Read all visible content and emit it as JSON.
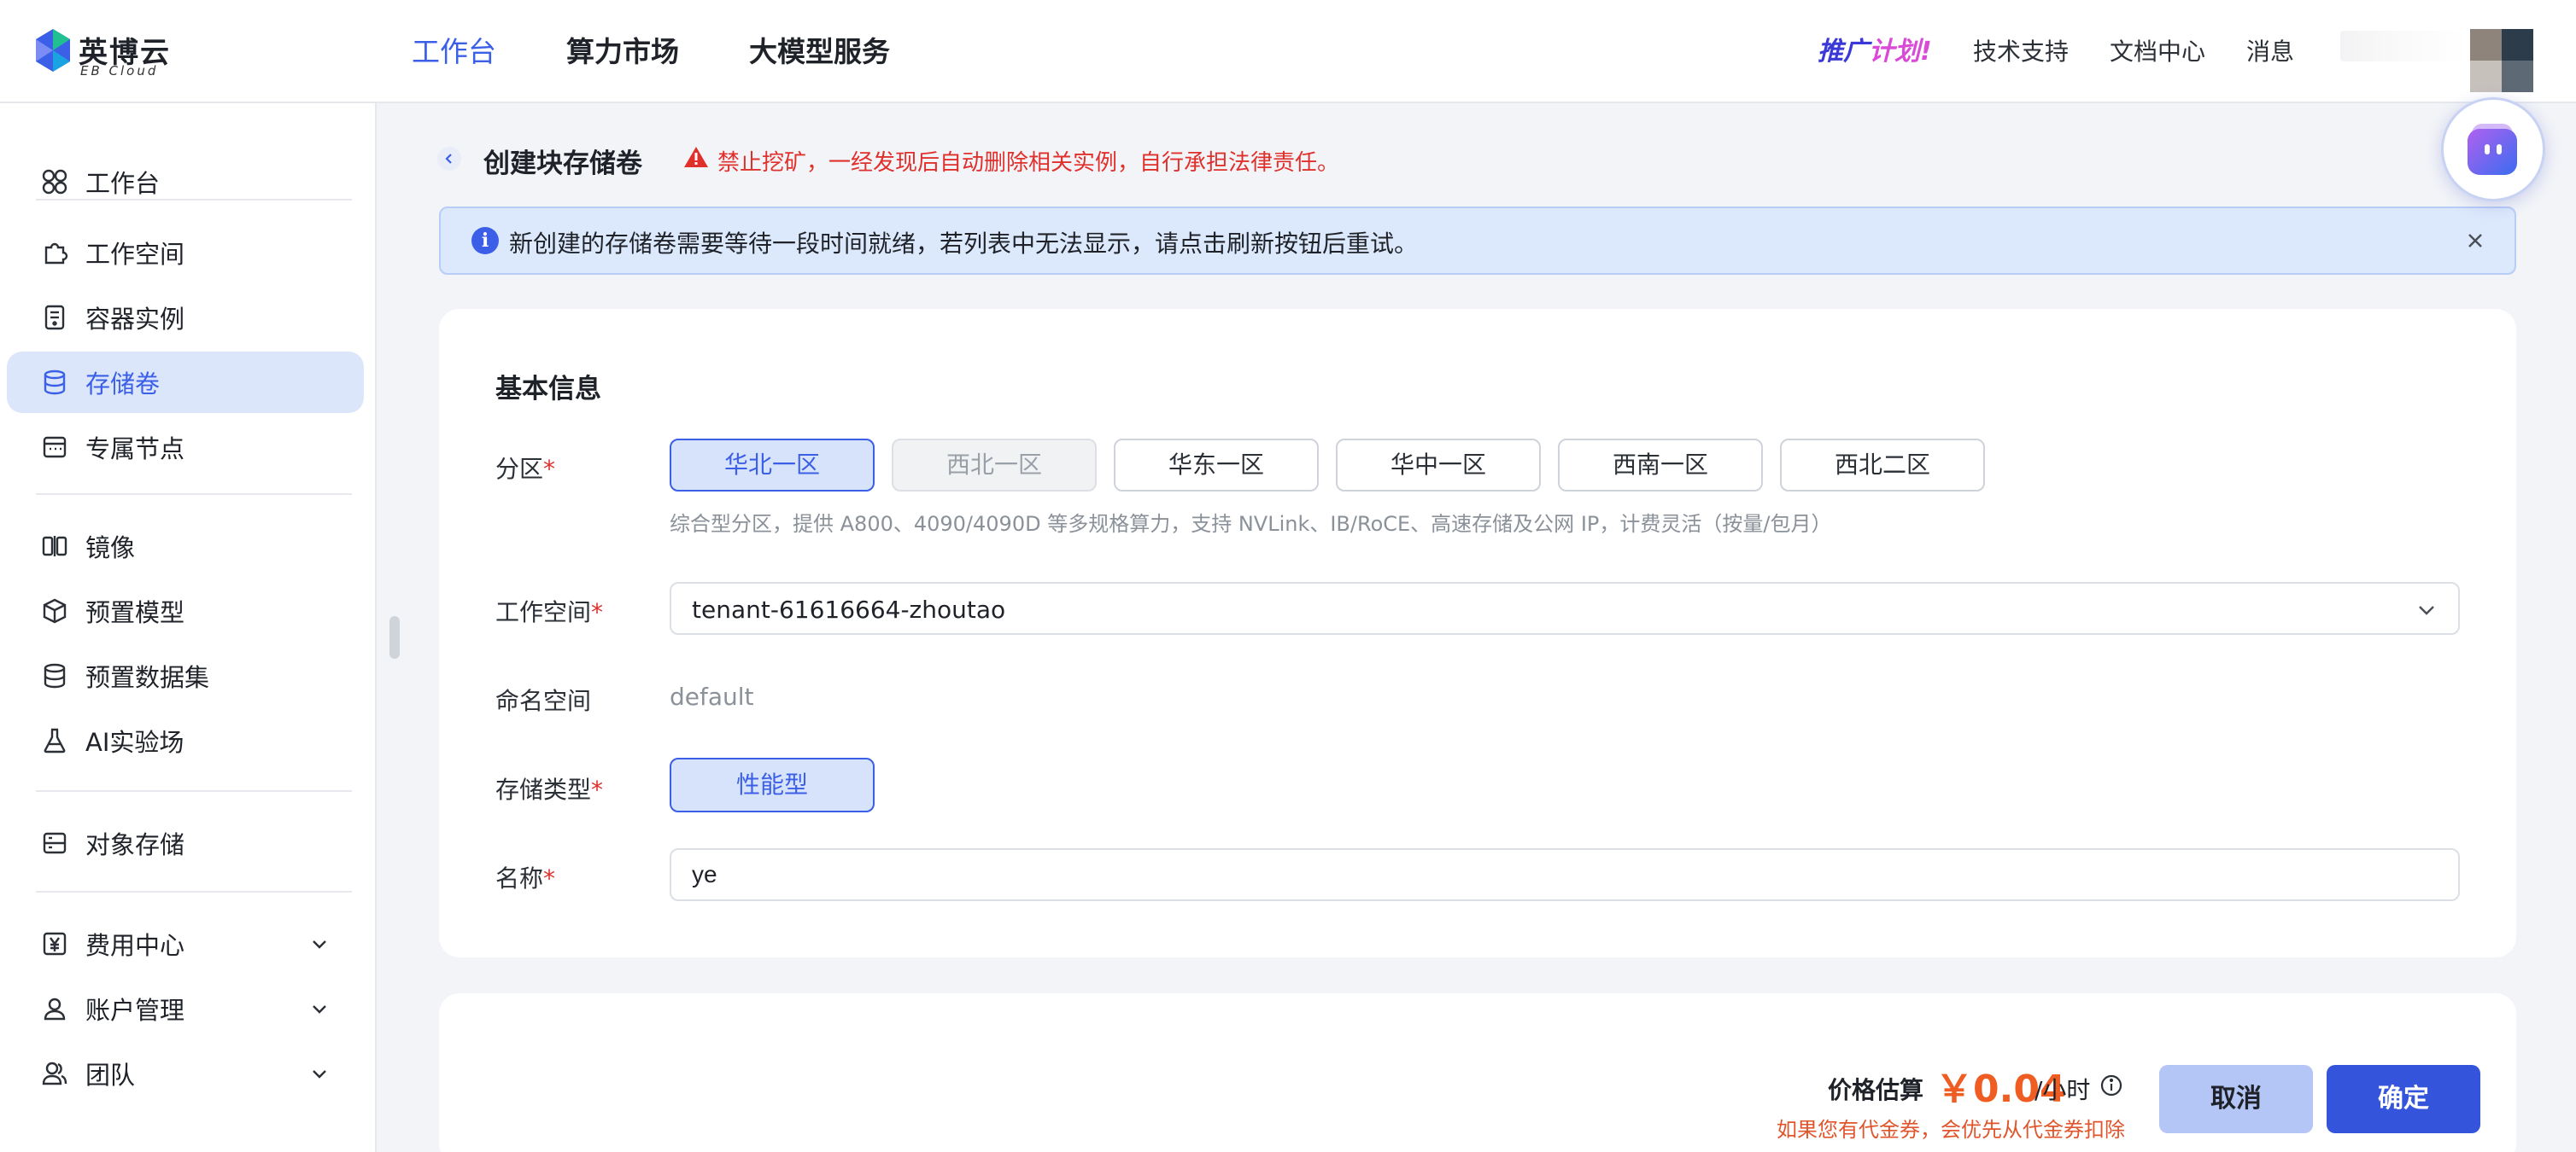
{
  "brand": {
    "name": "英博云",
    "sub": "EB Cloud"
  },
  "topnav": {
    "items": [
      {
        "label": "工作台",
        "active": true
      },
      {
        "label": "算力市场",
        "active": false
      },
      {
        "label": "大模型服务",
        "active": false
      }
    ]
  },
  "topright": {
    "promo_a": "推广",
    "promo_b": "计划",
    "links": [
      "技术支持",
      "文档中心",
      "消息"
    ]
  },
  "sidebar": {
    "items": [
      {
        "label": "工作台",
        "icon": "dashboard-icon"
      },
      {
        "label": "工作空间",
        "icon": "puzzle-icon"
      },
      {
        "label": "容器实例",
        "icon": "container-icon"
      },
      {
        "label": "存储卷",
        "icon": "database-icon",
        "active": true
      },
      {
        "label": "专属节点",
        "icon": "node-icon"
      },
      {
        "label": "镜像",
        "icon": "image-icon"
      },
      {
        "label": "预置模型",
        "icon": "cube-icon"
      },
      {
        "label": "预置数据集",
        "icon": "dataset-icon"
      },
      {
        "label": "AI实验场",
        "icon": "flask-icon"
      },
      {
        "label": "对象存储",
        "icon": "bucket-icon"
      },
      {
        "label": "费用中心",
        "icon": "yen-icon"
      },
      {
        "label": "账户管理",
        "icon": "user-icon"
      },
      {
        "label": "团队",
        "icon": "team-icon"
      }
    ]
  },
  "page": {
    "title": "创建块存储卷",
    "warning": "禁止挖矿，一经发现后自动删除相关实例，自行承担法律责任。",
    "banner": "新创建的存储卷需要等待一段时间就绪，若列表中无法显示，请点击刷新按钮后重试。"
  },
  "form": {
    "section_title": "基本信息",
    "zone_label": "分区",
    "zones": [
      {
        "label": "华北一区",
        "state": "selected"
      },
      {
        "label": "西北一区",
        "state": "disabled"
      },
      {
        "label": "华东一区",
        "state": "normal"
      },
      {
        "label": "华中一区",
        "state": "normal"
      },
      {
        "label": "西南一区",
        "state": "normal"
      },
      {
        "label": "西北二区",
        "state": "normal"
      }
    ],
    "zone_hint": "综合型分区，提供 A800、4090/4090D 等多规格算力，支持 NVLink、IB/RoCE、高速存储及公网 IP，计费灵活（按量/包月）",
    "workspace_label": "工作空间",
    "workspace_value": "tenant-61616664-zhoutao",
    "namespace_label": "命名空间",
    "namespace_value": "default",
    "storage_type_label": "存储类型",
    "storage_type_value": "性能型",
    "name_label": "名称",
    "name_value": "ye",
    "required_mark": "*"
  },
  "footer": {
    "price_label": "价格估算",
    "price_value": "￥0.04",
    "price_unit": "/小时",
    "price_note": "如果您有代金券，会优先从代金券扣除",
    "cancel": "取消",
    "confirm": "确定"
  },
  "colors": {
    "accent": "#3b5fe6",
    "danger": "#e0302c",
    "price": "#ef5d22",
    "banner_bg": "#dce8fc"
  }
}
